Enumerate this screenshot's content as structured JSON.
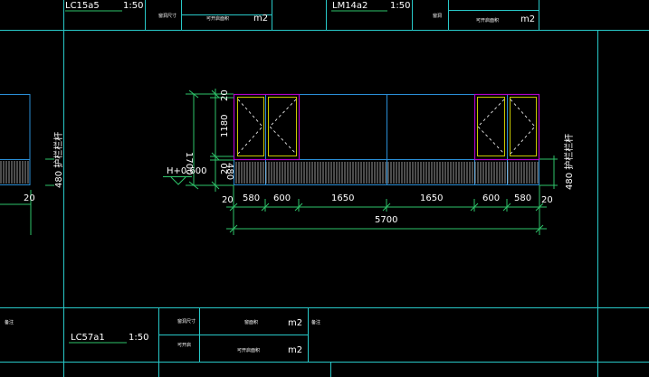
{
  "colors": {
    "frame": "#28c8c8",
    "window": "#2a8ed6",
    "sash": "#c8c800",
    "pane": "#b000c8",
    "dimension": "#2ec46a",
    "text": "#ffffff"
  },
  "top_strip": {
    "left_code": "LC15a5",
    "left_scale": "1:50",
    "left_label1": "窗洞尺寸",
    "left_label2": "可开启面积",
    "left_unit": "m2",
    "right_code": "LM14a2",
    "right_scale": "1:50",
    "right_label1": "窗洞",
    "right_label2": "可开启面积",
    "right_unit": "m2"
  },
  "elevation": {
    "heights": {
      "top": "20",
      "glass": "1180",
      "bottom_a": "20",
      "bottom_b": "480",
      "total": "1700"
    },
    "level_marker": "H+0.600",
    "side_note_right": "480 护栏栏杆",
    "side_note_left": "480 护栏栏杆",
    "widths": [
      "580",
      "600",
      "1650",
      "1650",
      "600",
      "580"
    ],
    "left_margin": "20",
    "right_margin": "20",
    "total_width": "5700",
    "left_offset": "20"
  },
  "bottom_strip": {
    "left_label": "备注",
    "code": "LC57a1",
    "scale": "1:50",
    "label1": "窗洞尺寸",
    "label2": "可开启",
    "area_label": "窗面积",
    "area_unit": "m2",
    "open_label": "可开启面积",
    "open_unit": "m2",
    "right_label": "备注"
  }
}
